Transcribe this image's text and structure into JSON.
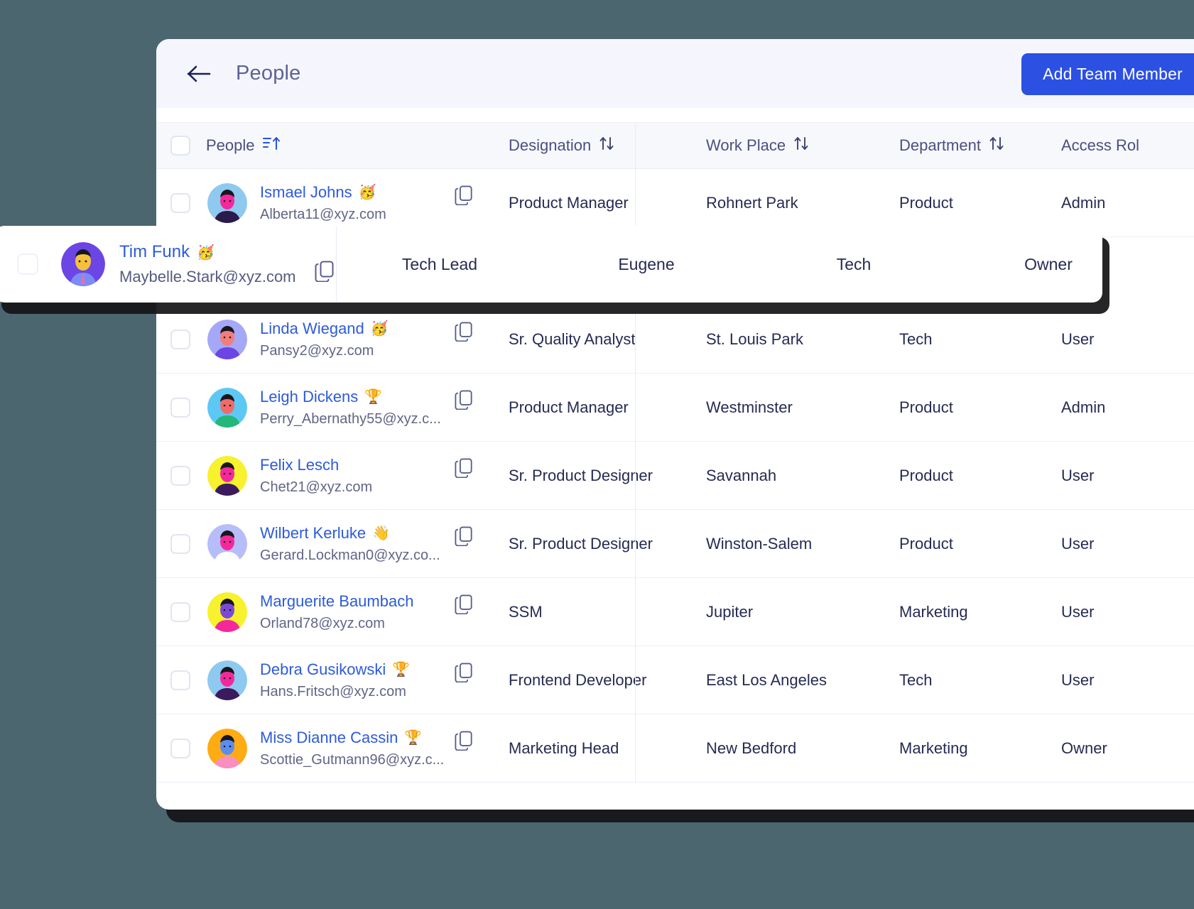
{
  "theme": {
    "page_background": "#4c6670",
    "accent": "#2b50e2",
    "link": "#2d5bdb",
    "header_bar": "#f5f6fd",
    "table_header": "#f7f8fb"
  },
  "titlebar": {
    "back_icon": "arrow-left-icon",
    "title": "People",
    "primary_button": "Add Team Member",
    "dropdown_icon": "chevron-down-icon"
  },
  "table": {
    "columns": [
      {
        "label": "People",
        "sort_icon": "filter-sort-asc-icon"
      },
      {
        "label": "Designation",
        "sort_icon": "sort-updown-icon"
      },
      {
        "label": "Work Place",
        "sort_icon": "sort-updown-icon"
      },
      {
        "label": "Department",
        "sort_icon": "sort-updown-icon"
      },
      {
        "label": "Access Rol",
        "sort_icon": "none"
      }
    ],
    "rows": [
      {
        "name": "Ismael Johns",
        "badge": "🥳",
        "email": "Alberta11@xyz.com",
        "designation": "Product Manager",
        "workplace": "Rohnert Park",
        "department": "Product",
        "access_role": "Admin",
        "avatar": "avatar-ismael"
      },
      {
        "name": "",
        "badge": "",
        "email": "",
        "designation": "",
        "workplace": "",
        "department": "",
        "access_role": "",
        "avatar": "avatar-hidden"
      },
      {
        "name": "Linda Wiegand",
        "badge": "🥳",
        "email": "Pansy2@xyz.com",
        "designation": "Sr. Quality Analyst",
        "workplace": "St. Louis Park",
        "department": "Tech",
        "access_role": "User",
        "avatar": "avatar-linda"
      },
      {
        "name": "Leigh Dickens",
        "badge": "🏆",
        "email": "Perry_Abernathy55@xyz.c...",
        "designation": "Product Manager",
        "workplace": "Westminster",
        "department": "Product",
        "access_role": "Admin",
        "avatar": "avatar-leigh"
      },
      {
        "name": "Felix Lesch",
        "badge": "",
        "email": "Chet21@xyz.com",
        "designation": "Sr. Product Designer",
        "workplace": "Savannah",
        "department": "Product",
        "access_role": "User",
        "avatar": "avatar-felix"
      },
      {
        "name": "Wilbert Kerluke",
        "badge": "👋",
        "email": "Gerard.Lockman0@xyz.co...",
        "designation": "Sr. Product Designer",
        "workplace": "Winston-Salem",
        "department": "Product",
        "access_role": "User",
        "avatar": "avatar-wilbert"
      },
      {
        "name": "Marguerite Baumbach",
        "badge": "",
        "email": "Orland78@xyz.com",
        "designation": "SSM",
        "workplace": "Jupiter",
        "department": "Marketing",
        "access_role": "User",
        "avatar": "avatar-marguerite"
      },
      {
        "name": "Debra Gusikowski",
        "badge": "🏆",
        "email": "Hans.Fritsch@xyz.com",
        "designation": "Frontend Developer",
        "workplace": "East Los Angeles",
        "department": "Tech",
        "access_role": "User",
        "avatar": "avatar-debra"
      },
      {
        "name": "Miss Dianne Cassin",
        "badge": "🏆",
        "email": "Scottie_Gutmann96@xyz.c...",
        "designation": "Marketing Head",
        "workplace": "New Bedford",
        "department": "Marketing",
        "access_role": "Owner",
        "avatar": "avatar-dianne"
      }
    ]
  },
  "floating_row": {
    "name": "Tim Funk",
    "badge": "🥳",
    "email": "Maybelle.Stark@xyz.com",
    "designation": "Tech Lead",
    "workplace": "Eugene",
    "department": "Tech",
    "access_role": "Owner",
    "copy_icon": "copy-icon",
    "avatar": "avatar-tim"
  }
}
